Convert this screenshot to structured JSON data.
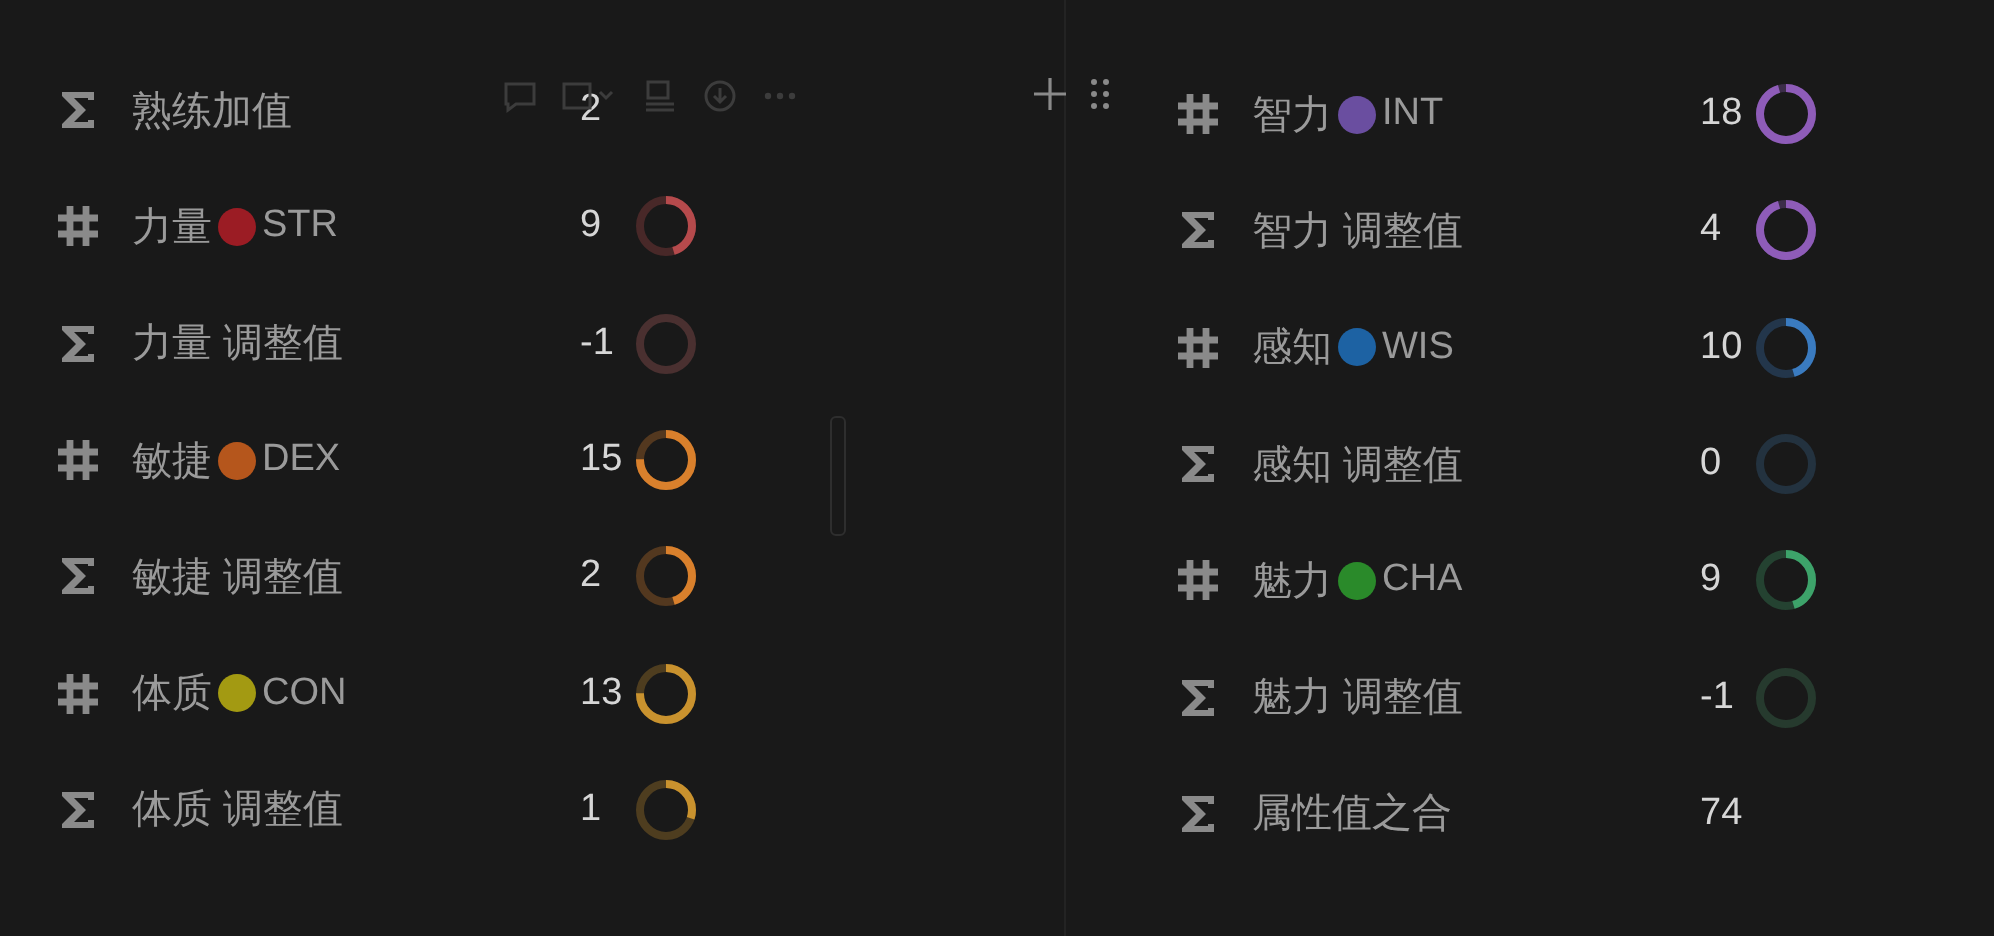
{
  "columns": [
    {
      "rows": [
        {
          "kind": "formula",
          "label": "熟练加值",
          "value": "2"
        },
        {
          "kind": "number",
          "label": "力量",
          "color": "#9b1c24",
          "abbr": "STR",
          "value": "9",
          "ring": {
            "kind": "half",
            "color": "#b54a4c"
          }
        },
        {
          "kind": "formula",
          "label": "力量 调整值",
          "value": "-1",
          "ring": {
            "kind": "empty",
            "color": "#4a3030"
          }
        },
        {
          "kind": "number",
          "label": "敏捷",
          "color": "#b5561c",
          "abbr": "DEX",
          "value": "15",
          "ring": {
            "kind": "most",
            "color": "#d9802c"
          }
        },
        {
          "kind": "formula",
          "label": "敏捷 调整值",
          "value": "2",
          "ring": {
            "kind": "half",
            "color": "#d9802c"
          }
        },
        {
          "kind": "number",
          "label": "体质",
          "color": "#a39a12",
          "abbr": "CON",
          "value": "13",
          "ring": {
            "kind": "most",
            "color": "#c9922e"
          }
        },
        {
          "kind": "formula",
          "label": "体质 调整值",
          "value": "1",
          "ring": {
            "kind": "quarter",
            "color": "#c9922e"
          }
        }
      ]
    },
    {
      "rows": [
        {
          "kind": "number",
          "label": "智力",
          "color": "#6a4ea0",
          "abbr": "INT",
          "value": "18",
          "ring": {
            "kind": "full",
            "color": "#8e5cb8"
          }
        },
        {
          "kind": "formula",
          "label": "智力 调整值",
          "value": "4",
          "ring": {
            "kind": "full",
            "color": "#8e5cb8"
          }
        },
        {
          "kind": "number",
          "label": "感知",
          "color": "#1d62a3",
          "abbr": "WIS",
          "value": "10",
          "ring": {
            "kind": "half",
            "color": "#3a7bc0"
          }
        },
        {
          "kind": "formula",
          "label": "感知 调整值",
          "value": "0",
          "ring": {
            "kind": "empty",
            "color": "#23323f"
          }
        },
        {
          "kind": "number",
          "label": "魅力",
          "color": "#2a8a2a",
          "abbr": "CHA",
          "value": "9",
          "ring": {
            "kind": "half",
            "color": "#3da36a"
          }
        },
        {
          "kind": "formula",
          "label": "魅力 调整值",
          "value": "-1",
          "ring": {
            "kind": "empty",
            "color": "#263a2e"
          }
        },
        {
          "kind": "formula",
          "label": "属性值之合",
          "value": "74"
        }
      ]
    }
  ]
}
